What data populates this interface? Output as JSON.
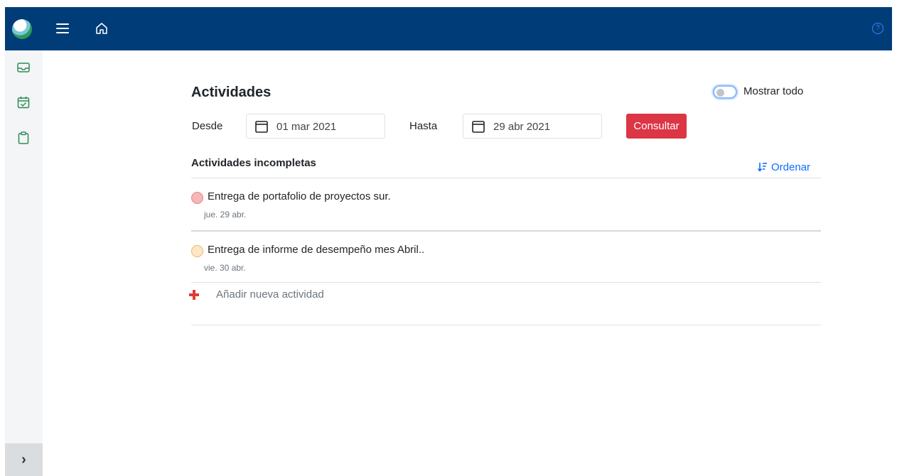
{
  "header": {
    "logo_icon": "app-logo",
    "menu_icon": "hamburger-icon",
    "home_icon": "home-icon",
    "help_icon": "help-icon",
    "help_glyph": "?"
  },
  "sidebar": {
    "items": [
      {
        "icon": "inbox-icon"
      },
      {
        "icon": "calendar-check-icon"
      },
      {
        "icon": "clipboard-icon"
      }
    ],
    "expand_glyph": "›"
  },
  "main": {
    "title": "Actividades",
    "show_all_label": "Mostrar todo",
    "show_all_checked": false,
    "from_label": "Desde",
    "from_value": "01 mar 2021",
    "to_label": "Hasta",
    "to_value": "29 abr 2021",
    "query_button": "Consultar",
    "section_title": "Actividades incompletas",
    "sort_label": "Ordenar",
    "activities": [
      {
        "text": "Entrega de portafolio de proyectos sur.",
        "date": "jue. 29 abr.",
        "status_color": "#f4b6b6",
        "status_border": "#e58a8a"
      },
      {
        "text": "Entrega de informe de desempeño mes Abril..",
        "date": "vie. 30 abr.",
        "status_color": "#fde7c8",
        "status_border": "#f2b661"
      }
    ],
    "add_label": "Añadir nueva actividad"
  },
  "colors": {
    "topbar": "#003d78",
    "accent_red": "#dc3545",
    "link_blue": "#0d6efd",
    "sidebar_icon_green": "#2e8b57"
  }
}
